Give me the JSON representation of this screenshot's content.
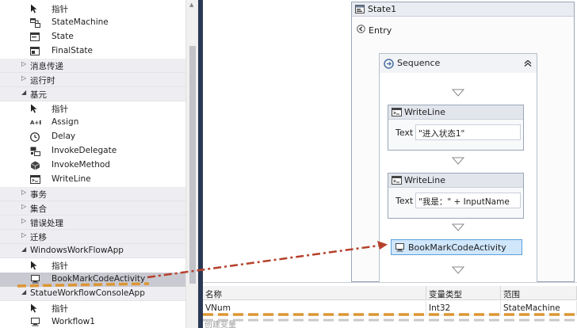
{
  "toolbox": {
    "rows": [
      {
        "kind": "item",
        "label": "指针",
        "icon": "pointer-icon"
      },
      {
        "kind": "item",
        "label": "StateMachine",
        "icon": "state-machine-icon"
      },
      {
        "kind": "item",
        "label": "State",
        "icon": "state-icon"
      },
      {
        "kind": "item",
        "label": "FinalState",
        "icon": "final-state-icon"
      },
      {
        "kind": "cat",
        "label": "消息传递",
        "arrow": "▷"
      },
      {
        "kind": "cat",
        "label": "运行时",
        "arrow": "▷"
      },
      {
        "kind": "cat",
        "label": "基元",
        "arrow": "◢"
      },
      {
        "kind": "item",
        "label": "指针",
        "icon": "pointer-icon"
      },
      {
        "kind": "item",
        "label": "Assign",
        "icon": "assign-icon"
      },
      {
        "kind": "item",
        "label": "Delay",
        "icon": "clock-icon"
      },
      {
        "kind": "item",
        "label": "InvokeDelegate",
        "icon": "invoke-delegate-icon"
      },
      {
        "kind": "item",
        "label": "InvokeMethod",
        "icon": "invoke-method-icon"
      },
      {
        "kind": "item",
        "label": "WriteLine",
        "icon": "writeline-icon"
      },
      {
        "kind": "cat",
        "label": "事务",
        "arrow": "▷"
      },
      {
        "kind": "cat",
        "label": "集合",
        "arrow": "▷"
      },
      {
        "kind": "cat",
        "label": "错误处理",
        "arrow": "▷"
      },
      {
        "kind": "cat",
        "label": "迁移",
        "arrow": "▷"
      },
      {
        "kind": "cat",
        "label": "WindowsWorkFlowApp",
        "arrow": "◢"
      },
      {
        "kind": "item",
        "label": "指针",
        "icon": "pointer-icon"
      },
      {
        "kind": "item",
        "label": "BookMarkCodeActivity",
        "icon": "activity-icon",
        "selected": true
      },
      {
        "kind": "cat",
        "label": "StatueWorkflowConsoleApp",
        "arrow": "◢"
      },
      {
        "kind": "item",
        "label": "指针",
        "icon": "pointer-icon"
      },
      {
        "kind": "item",
        "label": "Workflow1",
        "icon": "activity-icon"
      }
    ]
  },
  "designer": {
    "state_title": "State1",
    "entry_label": "Entry",
    "sequence_title": "Sequence",
    "writelines": [
      {
        "title": "WriteLine",
        "text_label": "Text",
        "value": "\"进入状态1\""
      },
      {
        "title": "WriteLine",
        "text_label": "Text",
        "value": "\"我是：\" + InputName"
      }
    ],
    "bookmark_activity": "BookMarkCodeActivity"
  },
  "variables": {
    "headers": [
      "名称",
      "变量类型",
      "范围"
    ],
    "rows": [
      [
        "VNum",
        "Int32",
        "StateMachine"
      ]
    ],
    "create_label": "创建变量"
  },
  "colors": {
    "divider": "#293955",
    "selection": "#c9c9d1",
    "annotation_red": "#b5412c",
    "annotation_orange": "#dc9633",
    "bookmark_highlight": "#cfe6fb"
  }
}
